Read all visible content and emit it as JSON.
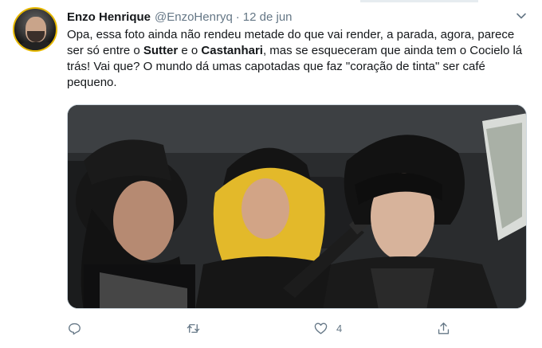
{
  "tweet": {
    "author": {
      "name": "Enzo Henrique",
      "handle": "@EnzoHenryq"
    },
    "separator": "·",
    "date": "12 de jun",
    "text": {
      "part1": "Opa, essa foto ainda não rendeu metade do que vai render, a parada, agora, parece ser só entre o ",
      "bold1": "Sutter",
      "part2": " e o ",
      "bold2": "Castanhari",
      "part3": ", mas se esqueceram que ainda tem o Cocielo lá trás! Vai que? O mundo dá umas capotadas que faz \"coração de tinta\" ser café pequeno."
    },
    "actions": {
      "reply_icon": "reply-icon",
      "retweet_icon": "retweet-icon",
      "like_icon": "heart-icon",
      "like_count": "4",
      "share_icon": "share-icon"
    }
  },
  "colors": {
    "text": "#14171a",
    "secondary": "#657786",
    "border": "#ccd6dd"
  }
}
